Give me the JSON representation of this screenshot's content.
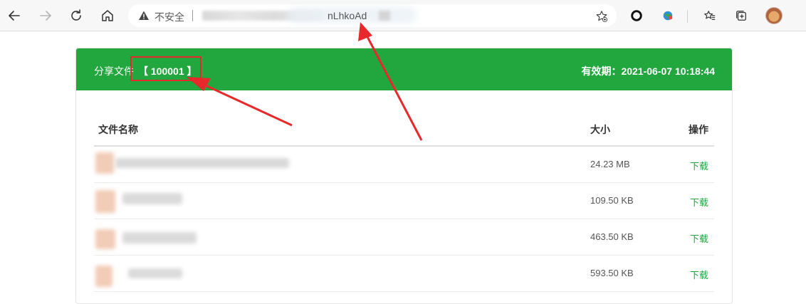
{
  "browser": {
    "security_label": "不安全",
    "url_visible_fragment": "nLhkoAd",
    "icons": [
      "back-arrow-icon",
      "forward-arrow-icon",
      "reload-icon",
      "home-icon",
      "warning-icon",
      "add-favorite-icon",
      "extension-circle-icon",
      "extension-globe-icon",
      "favorites-icon",
      "collections-icon",
      "profile-avatar"
    ]
  },
  "share": {
    "title_prefix": "分享文件",
    "code_text": "【 100001 】",
    "expiry_text": "有效期：2021-06-07 10:18:44",
    "header_color": "#22a63e"
  },
  "table": {
    "headers": {
      "name": "文件名称",
      "size": "大小",
      "action": "操作"
    },
    "rows": [
      {
        "size": "24.23 MB",
        "action": "下载"
      },
      {
        "size": "109.50 KB",
        "action": "下载"
      },
      {
        "size": "463.50 KB",
        "action": "下载"
      },
      {
        "size": "593.50 KB",
        "action": "下载"
      }
    ]
  },
  "annotation_color": "#e8292b"
}
